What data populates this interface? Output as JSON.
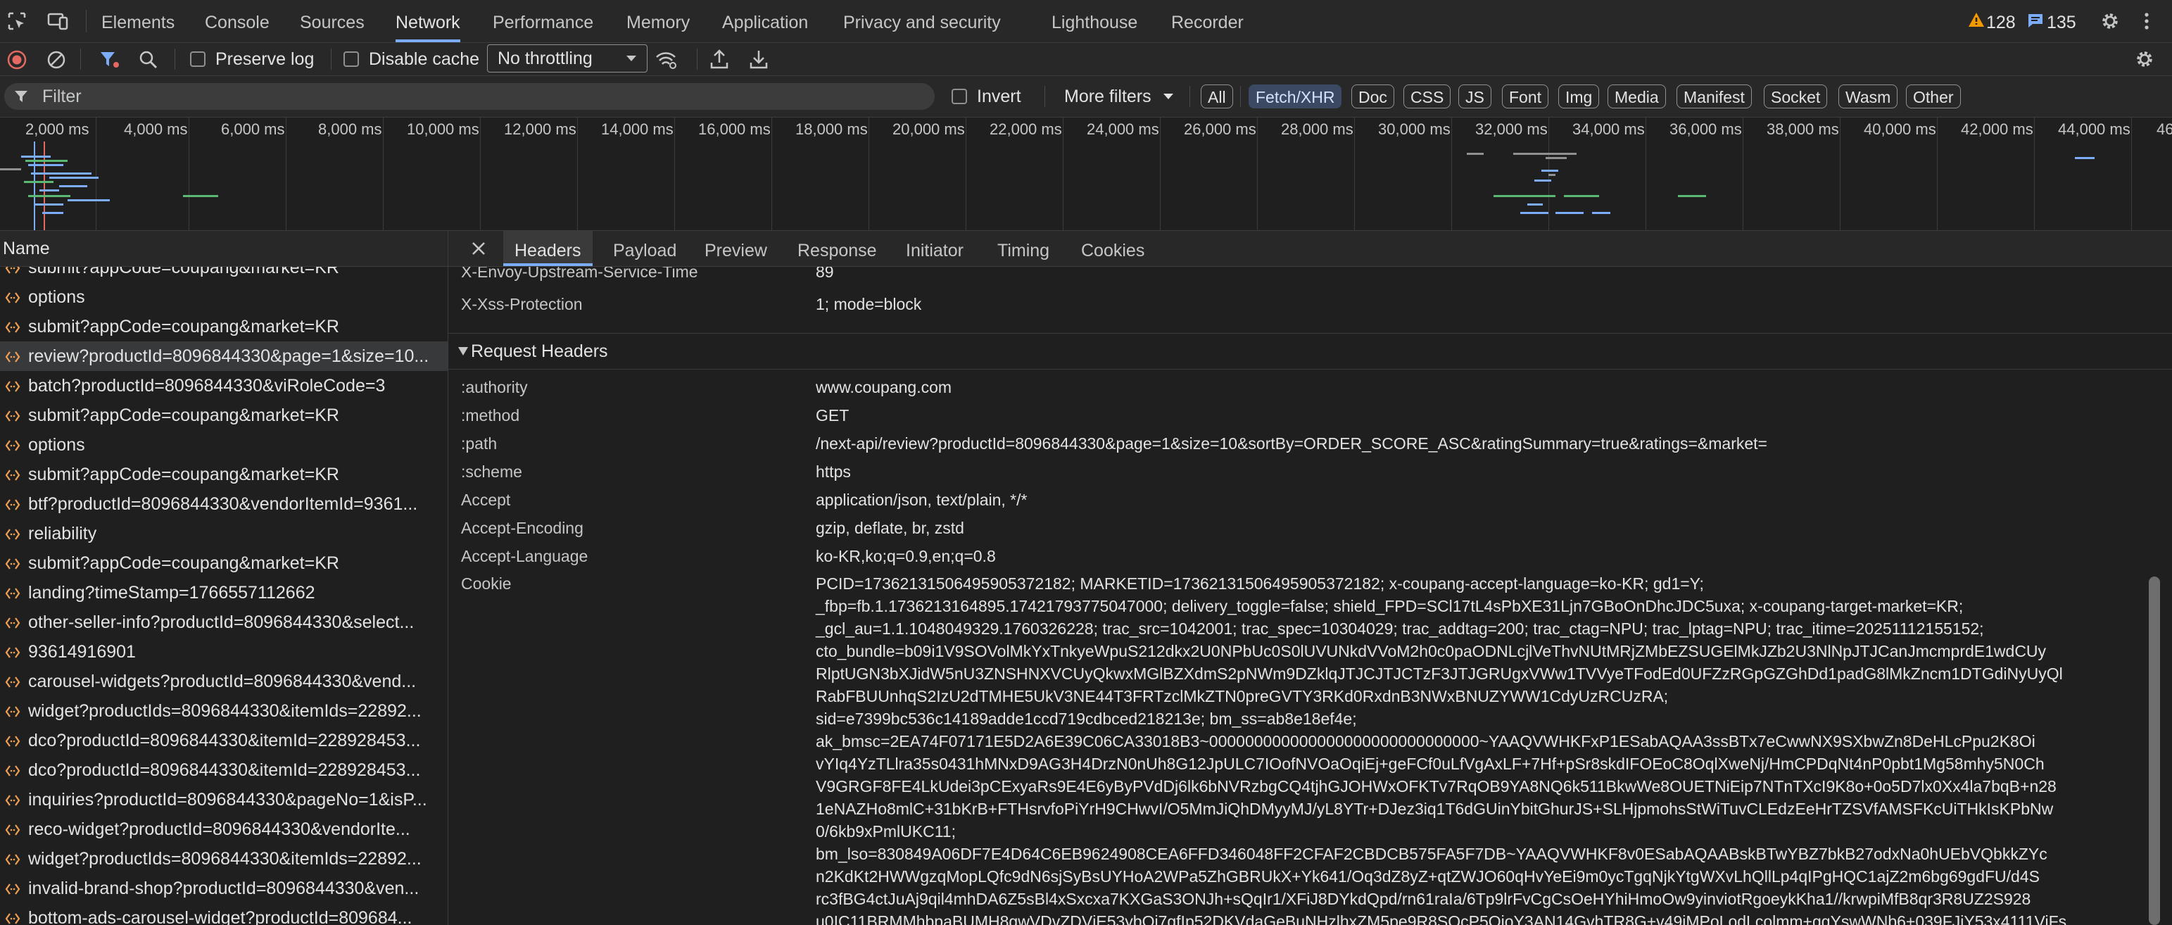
{
  "top_tabs": [
    "Elements",
    "Console",
    "Sources",
    "Network",
    "Performance",
    "Memory",
    "Application",
    "Privacy and security",
    "Lighthouse",
    "Recorder"
  ],
  "warnings_count": "128",
  "messages_count": "135",
  "toolbar": {
    "preserve_log": "Preserve log",
    "disable_cache": "Disable cache",
    "throttling": "No throttling"
  },
  "filter": {
    "placeholder": "Filter",
    "invert": "Invert",
    "more_filters": "More filters",
    "types": [
      "All",
      "Fetch/XHR",
      "Doc",
      "CSS",
      "JS",
      "Font",
      "Img",
      "Media",
      "Manifest",
      "Socket",
      "Wasm",
      "Other"
    ],
    "selected_type": "Fetch/XHR"
  },
  "timeline": {
    "ticks": [
      "2,000 ms",
      "4,000 ms",
      "6,000 ms",
      "8,000 ms",
      "10,000 ms",
      "12,000 ms",
      "14,000 ms",
      "16,000 ms",
      "18,000 ms",
      "20,000 ms",
      "22,000 ms",
      "24,000 ms",
      "26,000 ms",
      "28,000 ms",
      "30,000 ms",
      "32,000 ms",
      "34,000 ms",
      "36,000 ms",
      "38,000 ms",
      "40,000 ms",
      "42,000 ms",
      "44,000 ms",
      "46"
    ]
  },
  "request_list": {
    "header": "Name",
    "rows": [
      "submit?appCode=coupang&market=KR",
      "options",
      "submit?appCode=coupang&market=KR",
      "review?productId=8096844330&page=1&size=10...",
      "batch?productId=8096844330&viRoleCode=3",
      "submit?appCode=coupang&market=KR",
      "options",
      "submit?appCode=coupang&market=KR",
      "btf?productId=8096844330&vendorItemId=9361...",
      "reliability",
      "submit?appCode=coupang&market=KR",
      "landing?timeStamp=1766557112662",
      "other-seller-info?productId=8096844330&select...",
      "93614916901",
      "carousel-widgets?productId=8096844330&vend...",
      "widget?productIds=8096844330&itemIds=22892...",
      "dco?productId=8096844330&itemId=228928453...",
      "dco?productId=8096844330&itemId=228928453...",
      "inquiries?productId=8096844330&pageNo=1&isP...",
      "reco-widget?productId=8096844330&vendorIte...",
      "widget?productIds=8096844330&itemIds=22892...",
      "invalid-brand-shop?productId=8096844330&ven...",
      "bottom-ads-carousel-widget?productId=809684..."
    ],
    "selected_index": 3
  },
  "detail_tabs": [
    "Headers",
    "Payload",
    "Preview",
    "Response",
    "Initiator",
    "Timing",
    "Cookies"
  ],
  "response_headers_tail": [
    {
      "name": "X-Envoy-Upstream-Service-Time",
      "value": "89"
    },
    {
      "name": "X-Xss-Protection",
      "value": "1; mode=block"
    }
  ],
  "request_headers": {
    "title": "Request Headers",
    "items": [
      {
        "name": ":authority",
        "value": "www.coupang.com"
      },
      {
        "name": ":method",
        "value": "GET"
      },
      {
        "name": ":path",
        "value": "/next-api/review?productId=8096844330&page=1&size=10&sortBy=ORDER_SCORE_ASC&ratingSummary=true&ratings=&market="
      },
      {
        "name": ":scheme",
        "value": "https"
      },
      {
        "name": "Accept",
        "value": "application/json, text/plain, */*"
      },
      {
        "name": "Accept-Encoding",
        "value": "gzip, deflate, br, zstd"
      },
      {
        "name": "Accept-Language",
        "value": "ko-KR,ko;q=0.9,en;q=0.8"
      }
    ],
    "cookie_name": "Cookie",
    "cookie_lines": [
      "PCID=17362131506495905372182; MARKETID=17362131506495905372182; x-coupang-accept-language=ko-KR; gd1=Y;",
      "_fbp=fb.1.1736213164895.17421793775047000; delivery_toggle=false; shield_FPD=SCl17tL4sPbXE31Ljn7GBoOnDhcJDC5uxa; x-coupang-target-market=KR;",
      "_gcl_au=1.1.1048049329.1760326228; trac_src=1042001; trac_spec=10304029; trac_addtag=200; trac_ctag=NPU; trac_lptag=NPU; trac_itime=20251112155152;",
      "cto_bundle=b09i1V9SOVolMkYxTnkyeWpuS212dkx2U0NPbUc0S0lUVUNkdVVoM2h0c0paODNLcjlVeThvNUtMRjZMbEZSUGElMkJZb2U3NlNpJTJCanJmcmprdE1wdCUy",
      "RlptUGN3bXJidW5nU3ZNSHNXVCUyQkwxMGlBZXdmS2pNWm9DZklqJTJCJTJCTzF3JTJGRUgxVWw1TVVyeTFodEd0UFZzRGpGZGhDd1padG8lMkZncm1DTGdiNyUyQl",
      "RabFBUUnhqS2IzU2dTMHE5UkV3NE44T3FRTzclMkZTN0preGVTY3RKd0RxdnB3NWxBNUZYWW1CdyUzRCUzRA;",
      "sid=e7399bc536c14189adde1ccd719cdbced218213e; bm_ss=ab8e18ef4e;",
      "ak_bmsc=2EA74F07171E5D2A6E39C06CA33018B3~000000000000000000000000000000~YAAQVWHKFxP1ESabAQAA3ssBTx7eCwwNX9SXbwZn8DeHLcPpu2K8Oi",
      "vYIq4YzTLlra35s0431hMNxD9AG3H4DrzN0nUh8G12JpULC7IOofNVOaOqiEj+geFCf0uLfVgAxLF+7Hf+pSr8skdIFOEoC8OqlXweNj/HmCPDqNt4nP0pbt1Mg58mhy5N0Ch",
      "V9GRGF8FE4LkUdei3pCExyaRs9E4E6yByPVdDj6lk6bNVRzbgCQ4tjhGJOHWxOFKTv7RqOB9YA8NQ6k511BkwWe8OUETNiEip7NTnTXcI9K8o+0o5D7lx0Xx4la7bqB+n28",
      "1eNAZHo8mlC+31bKrB+FTHsrvfoPiYrH9CHwvI/O5MmJiQhDMyyMJ/yL8YTr+DJez3iq1T6dGUinYbitGhurJS+SLHjpmohsStWiTuvCLEdzEeHrTZSVfAMSFKcUiTHkIsKPbNw",
      "0/6kb9xPmlUKC11;",
      "bm_lso=830849A06DF7E4D64C6EB9624908CEA6FFD346048FF2CFAF2CBDCB575FA5F7DB~YAAQVWHKF8v0ESabAQAABskBTwYBZ7bkB27odxNa0hUEbVQbkkZYc",
      "n2KdKt2HWWgzqMopLQfc9dN6sjSyBsUYHoA2WPa5ZhGBRUkX+Yk641/Oq3dZ8yZ+qtZWJO60qHvYeEi9m0ycTgqNjkYtgWXvLhQllLp4qIPgHQC1ajZ2m6bg69gdFU/d4S",
      "rc3fBG4ctJuAj9qil4mhDA6Z5sBl4xSxcxa7KXGaS3ONJh+sQqIr1/XFiJ8DYkdQpd/rn61raIa/6Tp9lrFvCgCsOeHYhiHmoOw9yinviotRgoeykKha1//krwpiMfB8qr3R8UZ2S928",
      "u0IC11BRMMhbpaBUMH8gwVDvZDVjE53ybOi7gfIp52DKVdaGeBuNHzlhxZM5pe9R8SQcP5OioY3AN14GvhTR8G+v49iMPoLodLcolmm+ggYswWNb6+039FJjY53x4111ViFs"
    ]
  }
}
